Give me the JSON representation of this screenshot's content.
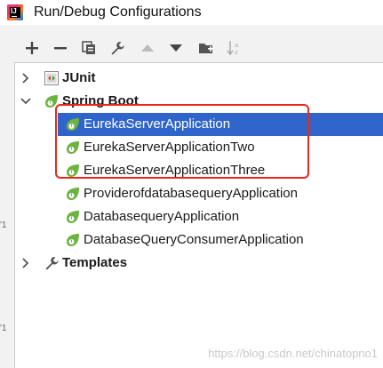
{
  "window": {
    "title": "Run/Debug Configurations"
  },
  "toolbar": {
    "buttons": [
      {
        "name": "add-button",
        "icon": "plus-icon"
      },
      {
        "name": "remove-button",
        "icon": "minus-icon"
      },
      {
        "name": "copy-button",
        "icon": "copy-icon"
      },
      {
        "name": "edit-defaults-button",
        "icon": "wrench-icon"
      },
      {
        "name": "move-up-button",
        "icon": "triangle-up-icon"
      },
      {
        "name": "move-down-button",
        "icon": "triangle-down-icon"
      },
      {
        "name": "new-folder-button",
        "icon": "folder-icon"
      },
      {
        "name": "sort-button",
        "icon": "sort-az-icon"
      }
    ]
  },
  "tree": {
    "junit": {
      "label": "JUnit",
      "expanded": false
    },
    "spring_boot": {
      "label": "Spring Boot",
      "expanded": true,
      "items": [
        {
          "label": "EurekaServerApplication",
          "selected": true
        },
        {
          "label": "EurekaServerApplicationTwo",
          "selected": false
        },
        {
          "label": "EurekaServerApplicationThree",
          "selected": false
        },
        {
          "label": "ProviderofdatabasequeryApplication",
          "selected": false
        },
        {
          "label": "DatabasequeryApplication",
          "selected": false
        },
        {
          "label": "DatabaseQueryConsumerApplication",
          "selected": false
        }
      ]
    },
    "templates": {
      "label": "Templates",
      "expanded": false
    }
  },
  "watermark": "https://blog.csdn.net/chinatopno1",
  "colors": {
    "selection": "#2f65ca",
    "highlight_box": "#e8281d",
    "spring_green": "#6db33f"
  }
}
